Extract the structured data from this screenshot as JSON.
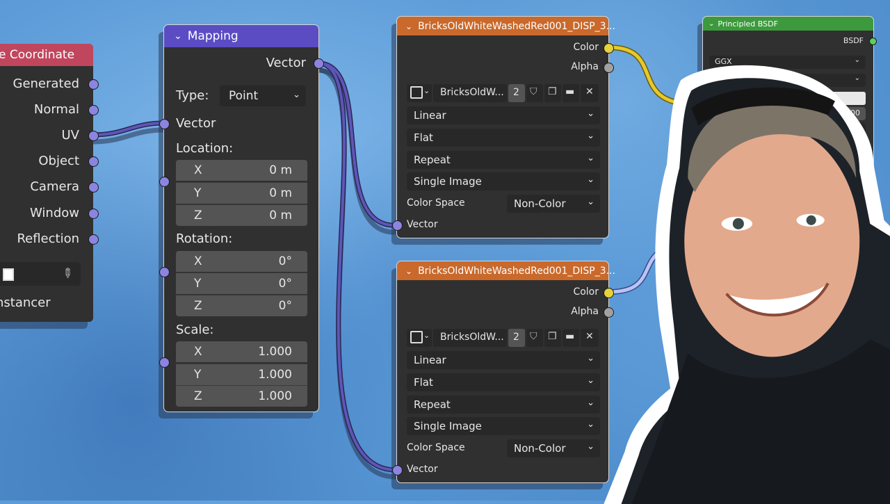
{
  "texcoord": {
    "title": "e Coordinate",
    "outputs": [
      "Generated",
      "Normal",
      "UV",
      "Object",
      "Camera",
      "Window",
      "Reflection"
    ],
    "instancer": "nstancer"
  },
  "mapping": {
    "title": "Mapping",
    "vector_out": "Vector",
    "type_label": "Type:",
    "type_value": "Point",
    "vector_in": "Vector",
    "location_label": "Location:",
    "location": [
      {
        "k": "X",
        "v": "0 m"
      },
      {
        "k": "Y",
        "v": "0 m"
      },
      {
        "k": "Z",
        "v": "0 m"
      }
    ],
    "rotation_label": "Rotation:",
    "rotation": [
      {
        "k": "X",
        "v": "0°"
      },
      {
        "k": "Y",
        "v": "0°"
      },
      {
        "k": "Z",
        "v": "0°"
      }
    ],
    "scale_label": "Scale:",
    "scale": [
      {
        "k": "X",
        "v": "1.000"
      },
      {
        "k": "Y",
        "v": "1.000"
      },
      {
        "k": "Z",
        "v": "1.000"
      }
    ]
  },
  "imgnode": {
    "title": "BricksOldWhiteWashedRed001_DISP_3...",
    "color_out": "Color",
    "alpha_out": "Alpha",
    "image_name": "BricksOldW...",
    "users": "2",
    "interpolation": "Linear",
    "projection": "Flat",
    "extension": "Repeat",
    "source": "Single Image",
    "colorspace_label": "Color Space",
    "colorspace_value": "Non-Color",
    "vector_in": "Vector"
  },
  "bsdf": {
    "title": "Principled BSDF",
    "out": "BSDF",
    "distribution": "GGX",
    "partial_value": "000"
  },
  "colors": {
    "texcoord_header": "#c0465e",
    "mapping_header": "#5b4cc4",
    "image_header": "#c9692b",
    "bsdf_header": "#3c9a3c",
    "wire_vector": "#4b4590",
    "wire_color": "#e6c92a",
    "accent_blue": "#1a2ee6"
  }
}
